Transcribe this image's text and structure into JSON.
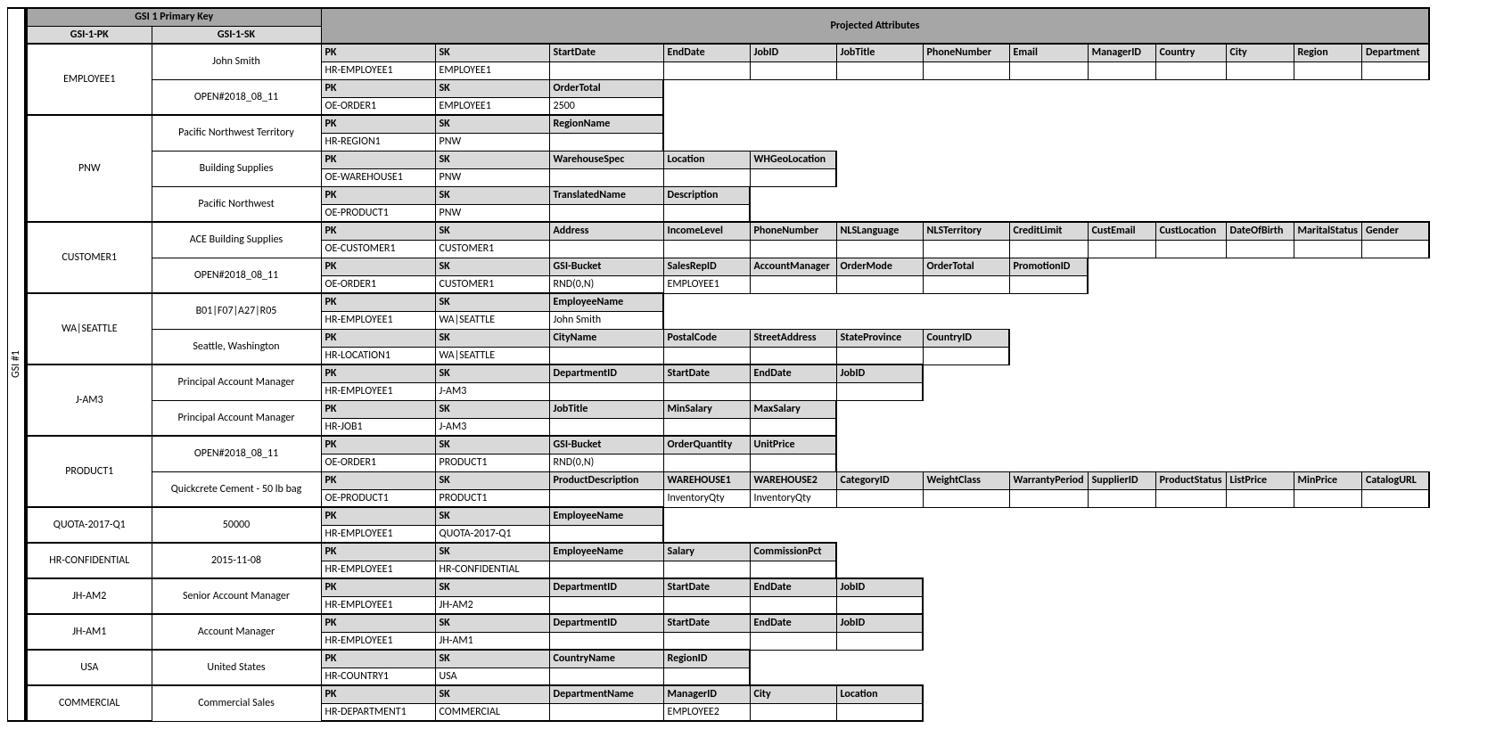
{
  "title": "GSI #1",
  "headers": {
    "primary": "GSI 1 Primary Key",
    "pk": "GSI-1-PK",
    "sk": "GSI-1-SK",
    "projected": "Projected Attributes"
  },
  "rows": [
    {
      "pk": "EMPLOYEE1",
      "items": [
        {
          "sk": "John Smith",
          "hdr": [
            "PK",
            "SK",
            "StartDate",
            "EndDate",
            "JobID",
            "JobTitle",
            "PhoneNumber",
            "Email",
            "ManagerID",
            "Country",
            "City",
            "Region",
            "Department"
          ],
          "val": [
            "HR-EMPLOYEE1",
            "EMPLOYEE1",
            "",
            "",
            "",
            "",
            "",
            "",
            "",
            "",
            "",
            "",
            ""
          ]
        },
        {
          "sk": "OPEN#2018_08_11",
          "hdr": [
            "PK",
            "SK",
            "OrderTotal"
          ],
          "val": [
            "OE-ORDER1",
            "EMPLOYEE1",
            "2500"
          ]
        }
      ]
    },
    {
      "pk": "PNW",
      "items": [
        {
          "sk": "Pacific Northwest Territory",
          "hdr": [
            "PK",
            "SK",
            "RegionName"
          ],
          "val": [
            "HR-REGION1",
            "PNW",
            ""
          ]
        },
        {
          "sk": "Building Supplies",
          "hdr": [
            "PK",
            "SK",
            "WarehouseSpec",
            "Location",
            "WHGeoLocation"
          ],
          "val": [
            "OE-WAREHOUSE1",
            "PNW",
            "",
            "",
            ""
          ]
        },
        {
          "sk": "Pacific Northwest",
          "hdr": [
            "PK",
            "SK",
            "TranslatedName",
            "Description"
          ],
          "val": [
            "OE-PRODUCT1",
            "PNW",
            "",
            ""
          ]
        }
      ]
    },
    {
      "pk": "CUSTOMER1",
      "items": [
        {
          "sk": "ACE Building Supplies",
          "hdr": [
            "PK",
            "SK",
            "Address",
            "IncomeLevel",
            "PhoneNumber",
            "NLSLanguage",
            "NLSTerritory",
            "CreditLimit",
            "CustEmail",
            "CustLocation",
            "DateOfBirth",
            "MaritalStatus",
            "Gender"
          ],
          "val": [
            "OE-CUSTOMER1",
            "CUSTOMER1",
            "",
            "",
            "",
            "",
            "",
            "",
            "",
            "",
            "",
            "",
            ""
          ]
        },
        {
          "sk": "OPEN#2018_08_11",
          "hdr": [
            "PK",
            "SK",
            "GSI-Bucket",
            "SalesRepID",
            "AccountManager",
            "OrderMode",
            "OrderTotal",
            "PromotionID"
          ],
          "val": [
            "OE-ORDER1",
            "CUSTOMER1",
            "RND(0,N)",
            "EMPLOYEE1",
            "",
            "",
            "",
            ""
          ]
        }
      ]
    },
    {
      "pk": "WA|SEATTLE",
      "items": [
        {
          "sk": "B01|F07|A27|R05",
          "hdr": [
            "PK",
            "SK",
            "EmployeeName"
          ],
          "val": [
            "HR-EMPLOYEE1",
            "WA|SEATTLE",
            "John Smith"
          ]
        },
        {
          "sk": "Seattle, Washington",
          "hdr": [
            "PK",
            "SK",
            "CityName",
            "PostalCode",
            "StreetAddress",
            "StateProvince",
            "CountryID"
          ],
          "val": [
            "HR-LOCATION1",
            "WA|SEATTLE",
            "",
            "",
            "",
            "",
            ""
          ]
        }
      ]
    },
    {
      "pk": "J-AM3",
      "items": [
        {
          "sk": "Principal Account Manager",
          "hdr": [
            "PK",
            "SK",
            "DepartmentID",
            "StartDate",
            "EndDate",
            "JobID"
          ],
          "val": [
            "HR-EMPLOYEE1",
            "J-AM3",
            "",
            "",
            "",
            ""
          ]
        },
        {
          "sk": "Principal Account Manager",
          "hdr": [
            "PK",
            "SK",
            "JobTitle",
            "MinSalary",
            "MaxSalary"
          ],
          "val": [
            "HR-JOB1",
            "J-AM3",
            "",
            "",
            ""
          ]
        }
      ]
    },
    {
      "pk": "PRODUCT1",
      "items": [
        {
          "sk": "OPEN#2018_08_11",
          "hdr": [
            "PK",
            "SK",
            "GSI-Bucket",
            "OrderQuantity",
            "UnitPrice"
          ],
          "val": [
            "OE-ORDER1",
            "PRODUCT1",
            "RND(0,N)",
            "",
            ""
          ]
        },
        {
          "sk": "Quickcrete Cement - 50 lb bag",
          "hdr": [
            "PK",
            "SK",
            "ProductDescription",
            "WAREHOUSE1",
            "WAREHOUSE2",
            "CategoryID",
            "WeightClass",
            "WarrantyPeriod",
            "SupplierID",
            "ProductStatus",
            "ListPrice",
            "MinPrice",
            "CatalogURL"
          ],
          "val": [
            "OE-PRODUCT1",
            "PRODUCT1",
            "",
            "InventoryQty",
            "InventoryQty",
            "",
            "",
            "",
            "",
            "",
            "",
            "",
            ""
          ]
        }
      ]
    },
    {
      "pk": "QUOTA-2017-Q1",
      "items": [
        {
          "sk": "50000",
          "hdr": [
            "PK",
            "SK",
            "EmployeeName"
          ],
          "val": [
            "HR-EMPLOYEE1",
            "QUOTA-2017-Q1",
            ""
          ]
        }
      ]
    },
    {
      "pk": "HR-CONFIDENTIAL",
      "items": [
        {
          "sk": "2015-11-08",
          "hdr": [
            "PK",
            "SK",
            "EmployeeName",
            "Salary",
            "CommissionPct"
          ],
          "val": [
            "HR-EMPLOYEE1",
            "HR-CONFIDENTIAL",
            "",
            "",
            ""
          ]
        }
      ]
    },
    {
      "pk": "JH-AM2",
      "items": [
        {
          "sk": "Senior Account Manager",
          "hdr": [
            "PK",
            "SK",
            "DepartmentID",
            "StartDate",
            "EndDate",
            "JobID"
          ],
          "val": [
            "HR-EMPLOYEE1",
            "JH-AM2",
            "",
            "",
            "",
            ""
          ]
        }
      ]
    },
    {
      "pk": "JH-AM1",
      "items": [
        {
          "sk": "Account Manager",
          "hdr": [
            "PK",
            "SK",
            "DepartmentID",
            "StartDate",
            "EndDate",
            "JobID"
          ],
          "val": [
            "HR-EMPLOYEE1",
            "JH-AM1",
            "",
            "",
            "",
            ""
          ]
        }
      ]
    },
    {
      "pk": "USA",
      "items": [
        {
          "sk": "United States",
          "hdr": [
            "PK",
            "SK",
            "CountryName",
            "RegionID"
          ],
          "val": [
            "HR-COUNTRY1",
            "USA",
            "",
            ""
          ]
        }
      ]
    },
    {
      "pk": "COMMERCIAL",
      "items": [
        {
          "sk": "Commercial Sales",
          "hdr": [
            "PK",
            "SK",
            "DepartmentName",
            "ManagerID",
            "City",
            "Location"
          ],
          "val": [
            "HR-DEPARTMENT1",
            "COMMERCIAL",
            "",
            "EMPLOYEE2",
            "",
            ""
          ]
        }
      ]
    }
  ]
}
